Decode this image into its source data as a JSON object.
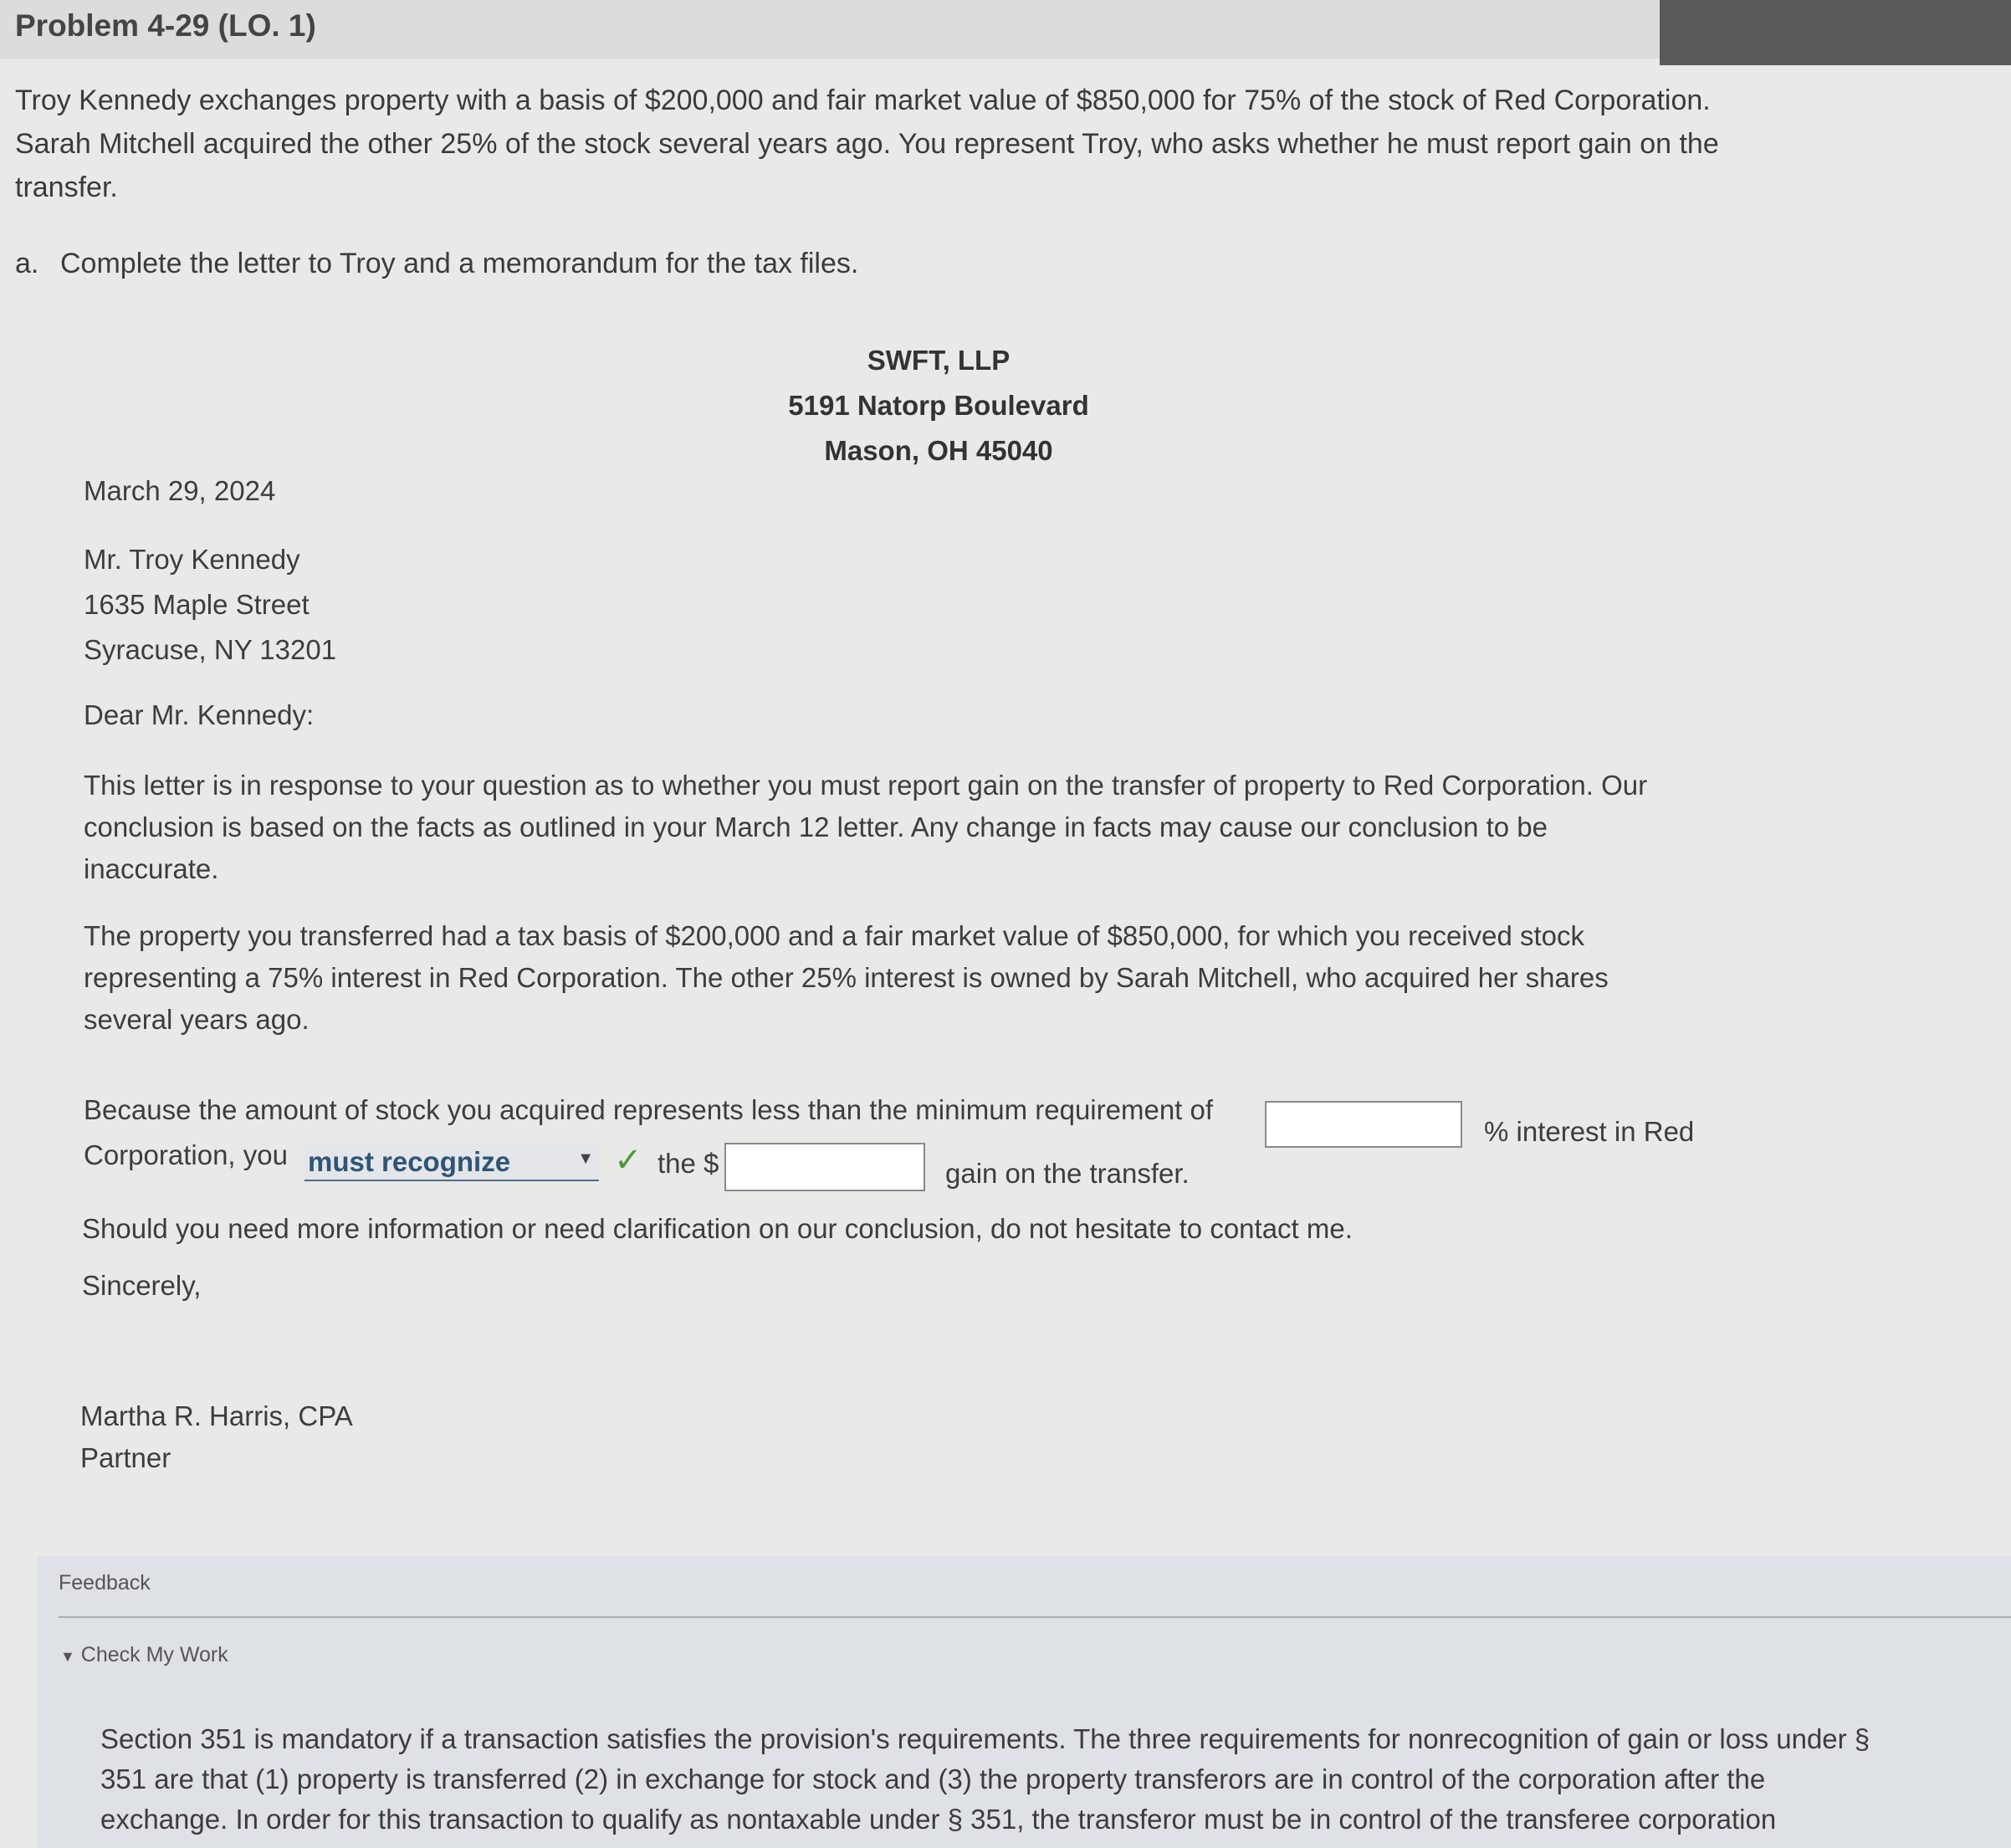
{
  "problem": {
    "title": "Problem 4-29 (LO. 1)",
    "intro_lines": [
      "Troy Kennedy exchanges property with a basis of $200,000 and fair market value of $850,000 for 75% of the stock of Red Corporation.",
      "Sarah Mitchell acquired the other 25% of the stock several years ago. You represent Troy, who asks whether he must report gain on the",
      "transfer."
    ],
    "part_a_letter": "a.",
    "part_a_text": "Complete the letter to Troy and a memorandum for the tax files."
  },
  "letterhead": {
    "firm": "SWFT, LLP",
    "street": "5191 Natorp Boulevard",
    "city": "Mason, OH 45040"
  },
  "letter": {
    "date": "March 29, 2024",
    "recipient_name": "Mr. Troy Kennedy",
    "recipient_street": "1635 Maple Street",
    "recipient_city": "Syracuse, NY 13201",
    "salutation": "Dear Mr. Kennedy:",
    "para1_lines": [
      "This letter is in response to your question as to whether you must report gain on the transfer of property to Red Corporation. Our",
      "conclusion is based on the facts as outlined in your March 12 letter. Any change in facts may cause our conclusion to be",
      "inaccurate."
    ],
    "para2_lines": [
      "The property you transferred had a tax basis of $200,000 and a fair market value of $850,000, for which you received stock",
      "representing a 75% interest in Red Corporation. The other 25% interest is owned by Sarah Mitchell, who acquired her shares",
      "several years ago."
    ],
    "para3_part1": "Because the amount of stock you acquired represents less than the minimum requirement of",
    "para3_part2": "% interest in Red",
    "para3_part3": "Corporation, you",
    "recognize_select_value": "must recognize",
    "para3_part4": "the $",
    "para3_part5": "gain on the transfer.",
    "min_requirement_value": "",
    "gain_amount_value": "",
    "closing_line": "Should you need more information or need clarification on our conclusion, do not hesitate to contact me.",
    "sign_off": "Sincerely,",
    "signer_name": "Martha R. Harris, CPA",
    "signer_title": "Partner"
  },
  "feedback": {
    "heading": "Feedback",
    "toggle_label": "Check My Work",
    "text_lines": [
      "Section 351 is mandatory if a transaction satisfies the provision's requirements. The three requirements for nonrecognition of gain or loss under §",
      "351 are that (1) property is transferred (2) in exchange for stock and (3) the property transferors are in control of the corporation after the",
      "exchange. In order for this transaction to qualify as nontaxable under § 351, the transferor must be in control of the transferee corporation"
    ]
  },
  "colors": {
    "check": "#4d9a3a",
    "select_text": "#2f5575"
  },
  "icons": {
    "check": "check-icon",
    "dropdown": "chevron-down-icon",
    "toggle": "triangle-down-icon"
  }
}
